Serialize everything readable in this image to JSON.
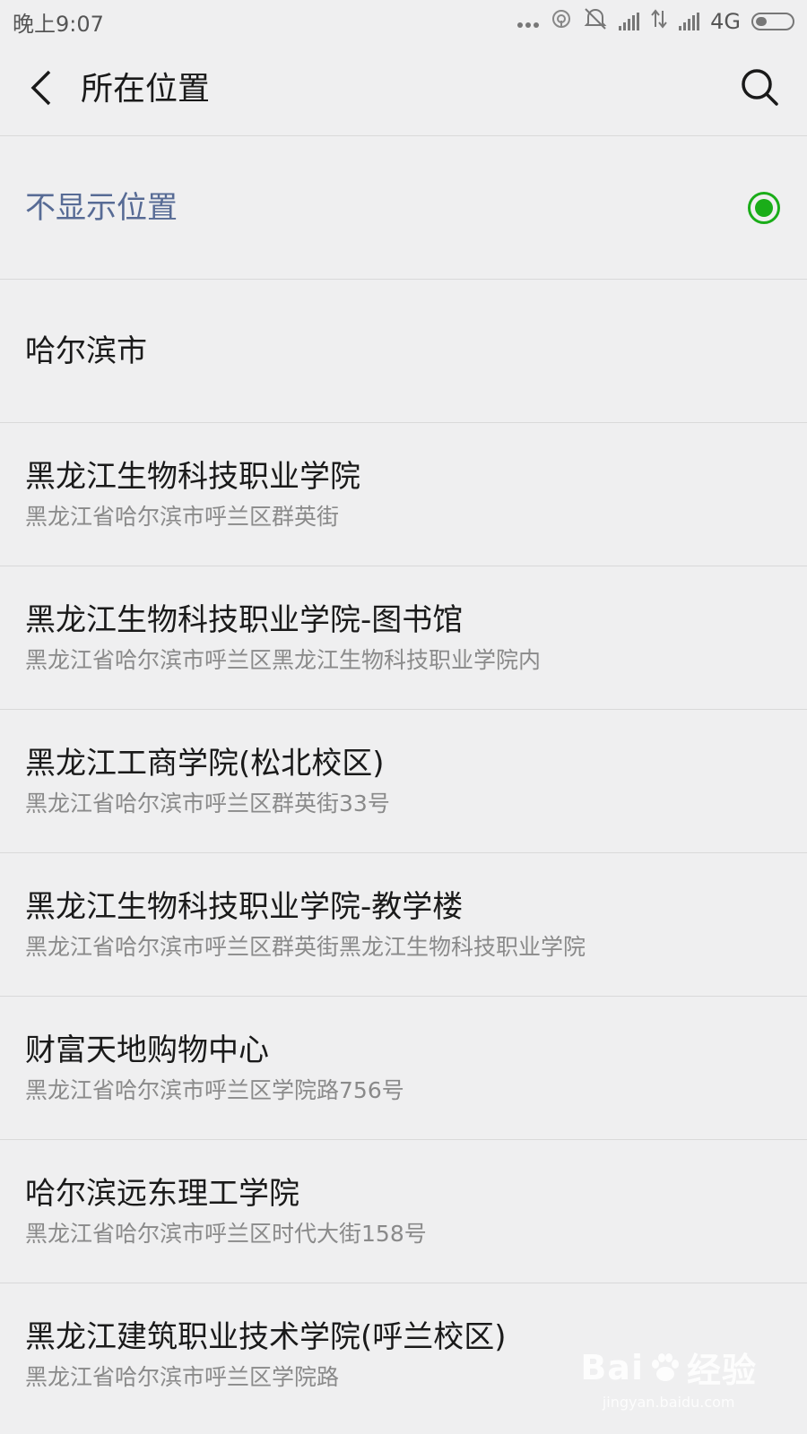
{
  "status_bar": {
    "time": "晚上9:07",
    "network": "4G",
    "icons": [
      "dots-icon",
      "hotspot-icon",
      "mute-icon",
      "signal-icon",
      "data-arrows-icon",
      "signal-icon",
      "battery-icon"
    ]
  },
  "header": {
    "title": "所在位置",
    "back_icon": "chevron-left-icon",
    "search_icon": "search-icon"
  },
  "options": {
    "hide_location": "不显示位置",
    "selected_color": "#1aad19"
  },
  "locations": [
    {
      "name": "哈尔滨市",
      "address": ""
    },
    {
      "name": "黑龙江生物科技职业学院",
      "address": "黑龙江省哈尔滨市呼兰区群英街"
    },
    {
      "name": "黑龙江生物科技职业学院-图书馆",
      "address": "黑龙江省哈尔滨市呼兰区黑龙江生物科技职业学院内"
    },
    {
      "name": "黑龙江工商学院(松北校区)",
      "address": "黑龙江省哈尔滨市呼兰区群英街33号"
    },
    {
      "name": "黑龙江生物科技职业学院-教学楼",
      "address": "黑龙江省哈尔滨市呼兰区群英街黑龙江生物科技职业学院"
    },
    {
      "name": "财富天地购物中心",
      "address": "黑龙江省哈尔滨市呼兰区学院路756号"
    },
    {
      "name": "哈尔滨远东理工学院",
      "address": "黑龙江省哈尔滨市呼兰区时代大街158号"
    },
    {
      "name": "黑龙江建筑职业技术学院(呼兰校区)",
      "address": "黑龙江省哈尔滨市呼兰区学院路"
    }
  ],
  "watermark": {
    "brand_left": "Bai",
    "brand_right": "经验",
    "url": "jingyan.baidu.com"
  }
}
